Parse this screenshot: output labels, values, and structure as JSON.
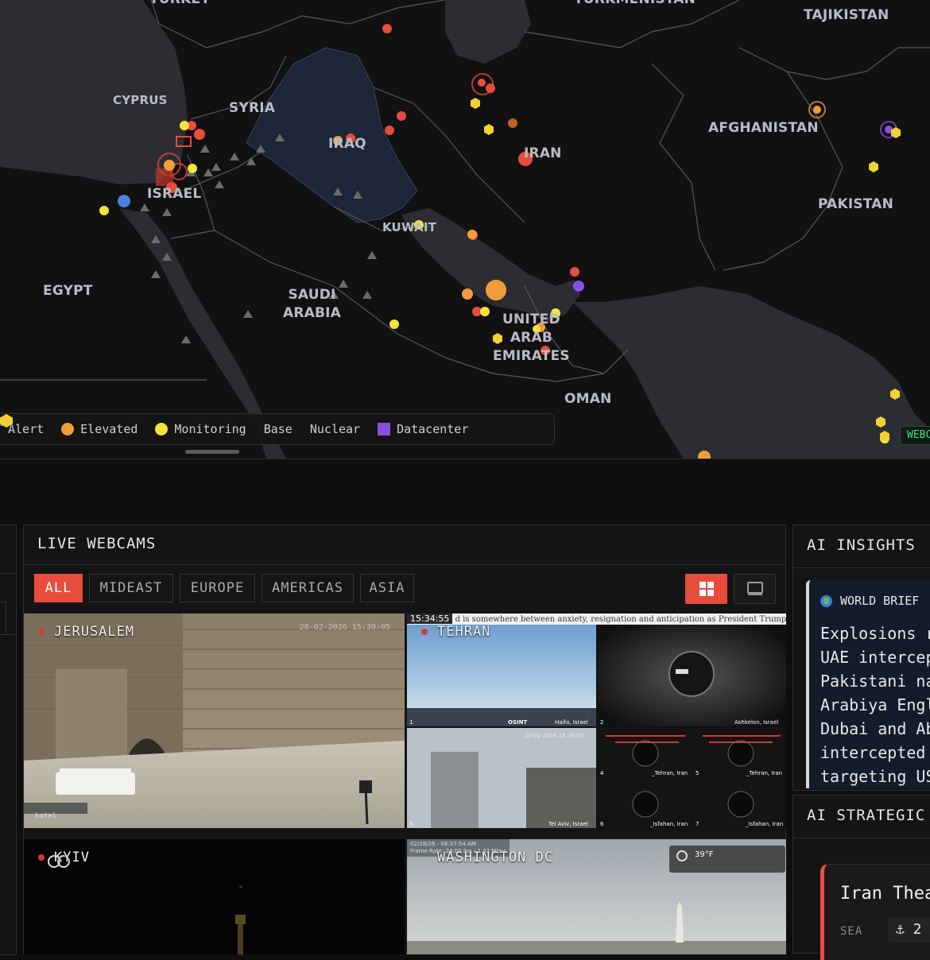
{
  "map": {
    "countries": [
      {
        "id": "turkey",
        "label": "TURKEY"
      },
      {
        "id": "turkmenistan",
        "label": "TURKMENISTAN"
      },
      {
        "id": "tajikistan",
        "label": "TAJIKISTAN"
      },
      {
        "id": "cyprus",
        "label": "CYPRUS"
      },
      {
        "id": "syria",
        "label": "SYRIA"
      },
      {
        "id": "iraq",
        "label": "IRAQ"
      },
      {
        "id": "iran",
        "label": "IRAN"
      },
      {
        "id": "afghanistan",
        "label": "AFGHANISTAN"
      },
      {
        "id": "israel",
        "label": "ISRAEL"
      },
      {
        "id": "pakistan",
        "label": "PAKISTAN"
      },
      {
        "id": "kuwait",
        "label": "KUWAIT"
      },
      {
        "id": "egypt",
        "label": "EGYPT"
      },
      {
        "id": "saudi",
        "label": "SAUDI\nARABIA"
      },
      {
        "id": "uae",
        "label": "UNITED\nARAB\nEMIRATES"
      },
      {
        "id": "oman",
        "label": "OMAN"
      }
    ],
    "legend": [
      {
        "label": "Alert",
        "kind": "none",
        "color": "#e84c3d"
      },
      {
        "label": "Elevated",
        "kind": "dot",
        "color": "#f39c3c"
      },
      {
        "label": "Monitoring",
        "kind": "dot",
        "color": "#f5e43a"
      },
      {
        "label": "Base",
        "kind": "triangle",
        "color": "#4a7fe0"
      },
      {
        "label": "Nuclear",
        "kind": "hexagon",
        "color": "#f2d232"
      },
      {
        "label": "Datacenter",
        "kind": "square",
        "color": "#8a4fe0"
      }
    ],
    "webcam_tag": "WEBCAMS",
    "colors": {
      "alert": "#e84c3d",
      "elevated": "#f39c3c",
      "monitoring": "#f5e43a",
      "base": "#6b6b6d",
      "nuclear": "#f2d232",
      "datacenter": "#8a4fe0"
    }
  },
  "webcams": {
    "title": "LIVE WEBCAMS",
    "tabs": [
      "ALL",
      "MIDEAST",
      "EUROPE",
      "AMERICAS",
      "ASIA"
    ],
    "active_tab": "ALL",
    "view_grid_icon": "grid-icon",
    "view_single_icon": "single-view-icon",
    "cams": [
      {
        "id": "jerusalem",
        "label": "JERUSALEM",
        "stamp": "28-02-2026 15:39:05",
        "watermark": "kotel"
      },
      {
        "id": "tehran",
        "label": "TEHRAN",
        "overlay_time": "15:34:55",
        "overlay_ticker": "d is somewhere between anxiety, resignation and anticipation as President Trump con",
        "tiles": [
          "1",
          "Haifa, Israel",
          "2",
          "Ashkelon, Israel",
          "3",
          "Tel Aviv, Israel",
          "4",
          "_Tehran, Iran",
          "5",
          "_Tehran, Iran",
          "6",
          "_Isfahan, Iran",
          "7",
          "_Isfahan, Iran"
        ],
        "tile_stamp": "28-02-2026 15:38:05",
        "brand": "OSINT"
      },
      {
        "id": "kyiv",
        "label": "KYIV"
      },
      {
        "id": "washington",
        "label": "WASHINGTON DC",
        "overlay_date": "02/28/26 - 08:37:54 AM",
        "overlay_frame": "Frame Rate: 24.00 fps - 1.32 Mbps",
        "temp": "39°F"
      }
    ]
  },
  "ai_insights": {
    "title": "AI INSIGHTS",
    "brief_label": "WORLD BRIEF",
    "lines": [
      "Explosions r",
      "UAE intercep",
      "Pakistani na",
      "Arabiya Engl",
      "Dubai and Ab",
      "intercepted",
      "targeting US"
    ]
  },
  "ai_strategic": {
    "title": "AI STRATEGIC",
    "card_title": "Iran Thea",
    "card_tag": "SEA",
    "card_badge": "⚓ 2"
  }
}
